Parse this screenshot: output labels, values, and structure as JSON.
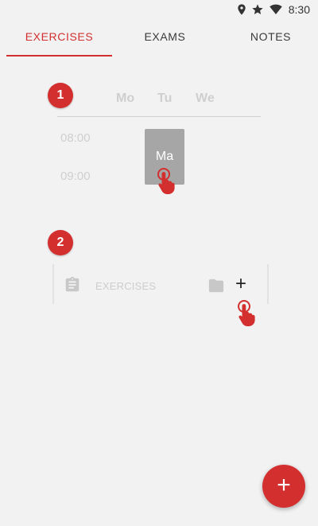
{
  "status_bar": {
    "time": "8:30",
    "icons": [
      "location-icon",
      "star-icon",
      "wifi-icon"
    ]
  },
  "tabs": [
    {
      "label": "EXERCISES",
      "active": true
    },
    {
      "label": "EXAMS",
      "active": false
    },
    {
      "label": "NOTES",
      "active": false
    }
  ],
  "colors": {
    "accent": "#d32f2f",
    "background": "#f2f2f2",
    "muted_text": "#cfcfcf",
    "lesson_block": "#a6a6a6"
  },
  "tutorial": {
    "step1": {
      "badge": "1",
      "days": [
        "Mo",
        "Tu",
        "We"
      ],
      "times": [
        "08:00",
        "09:00"
      ],
      "lesson_label": "Ma"
    },
    "step2": {
      "badge": "2",
      "exercise_title": "EXERCISES",
      "icons": [
        "clipboard-icon",
        "folder-icon",
        "add-icon"
      ],
      "add_symbol": "+"
    }
  },
  "fab": {
    "symbol": "+"
  }
}
